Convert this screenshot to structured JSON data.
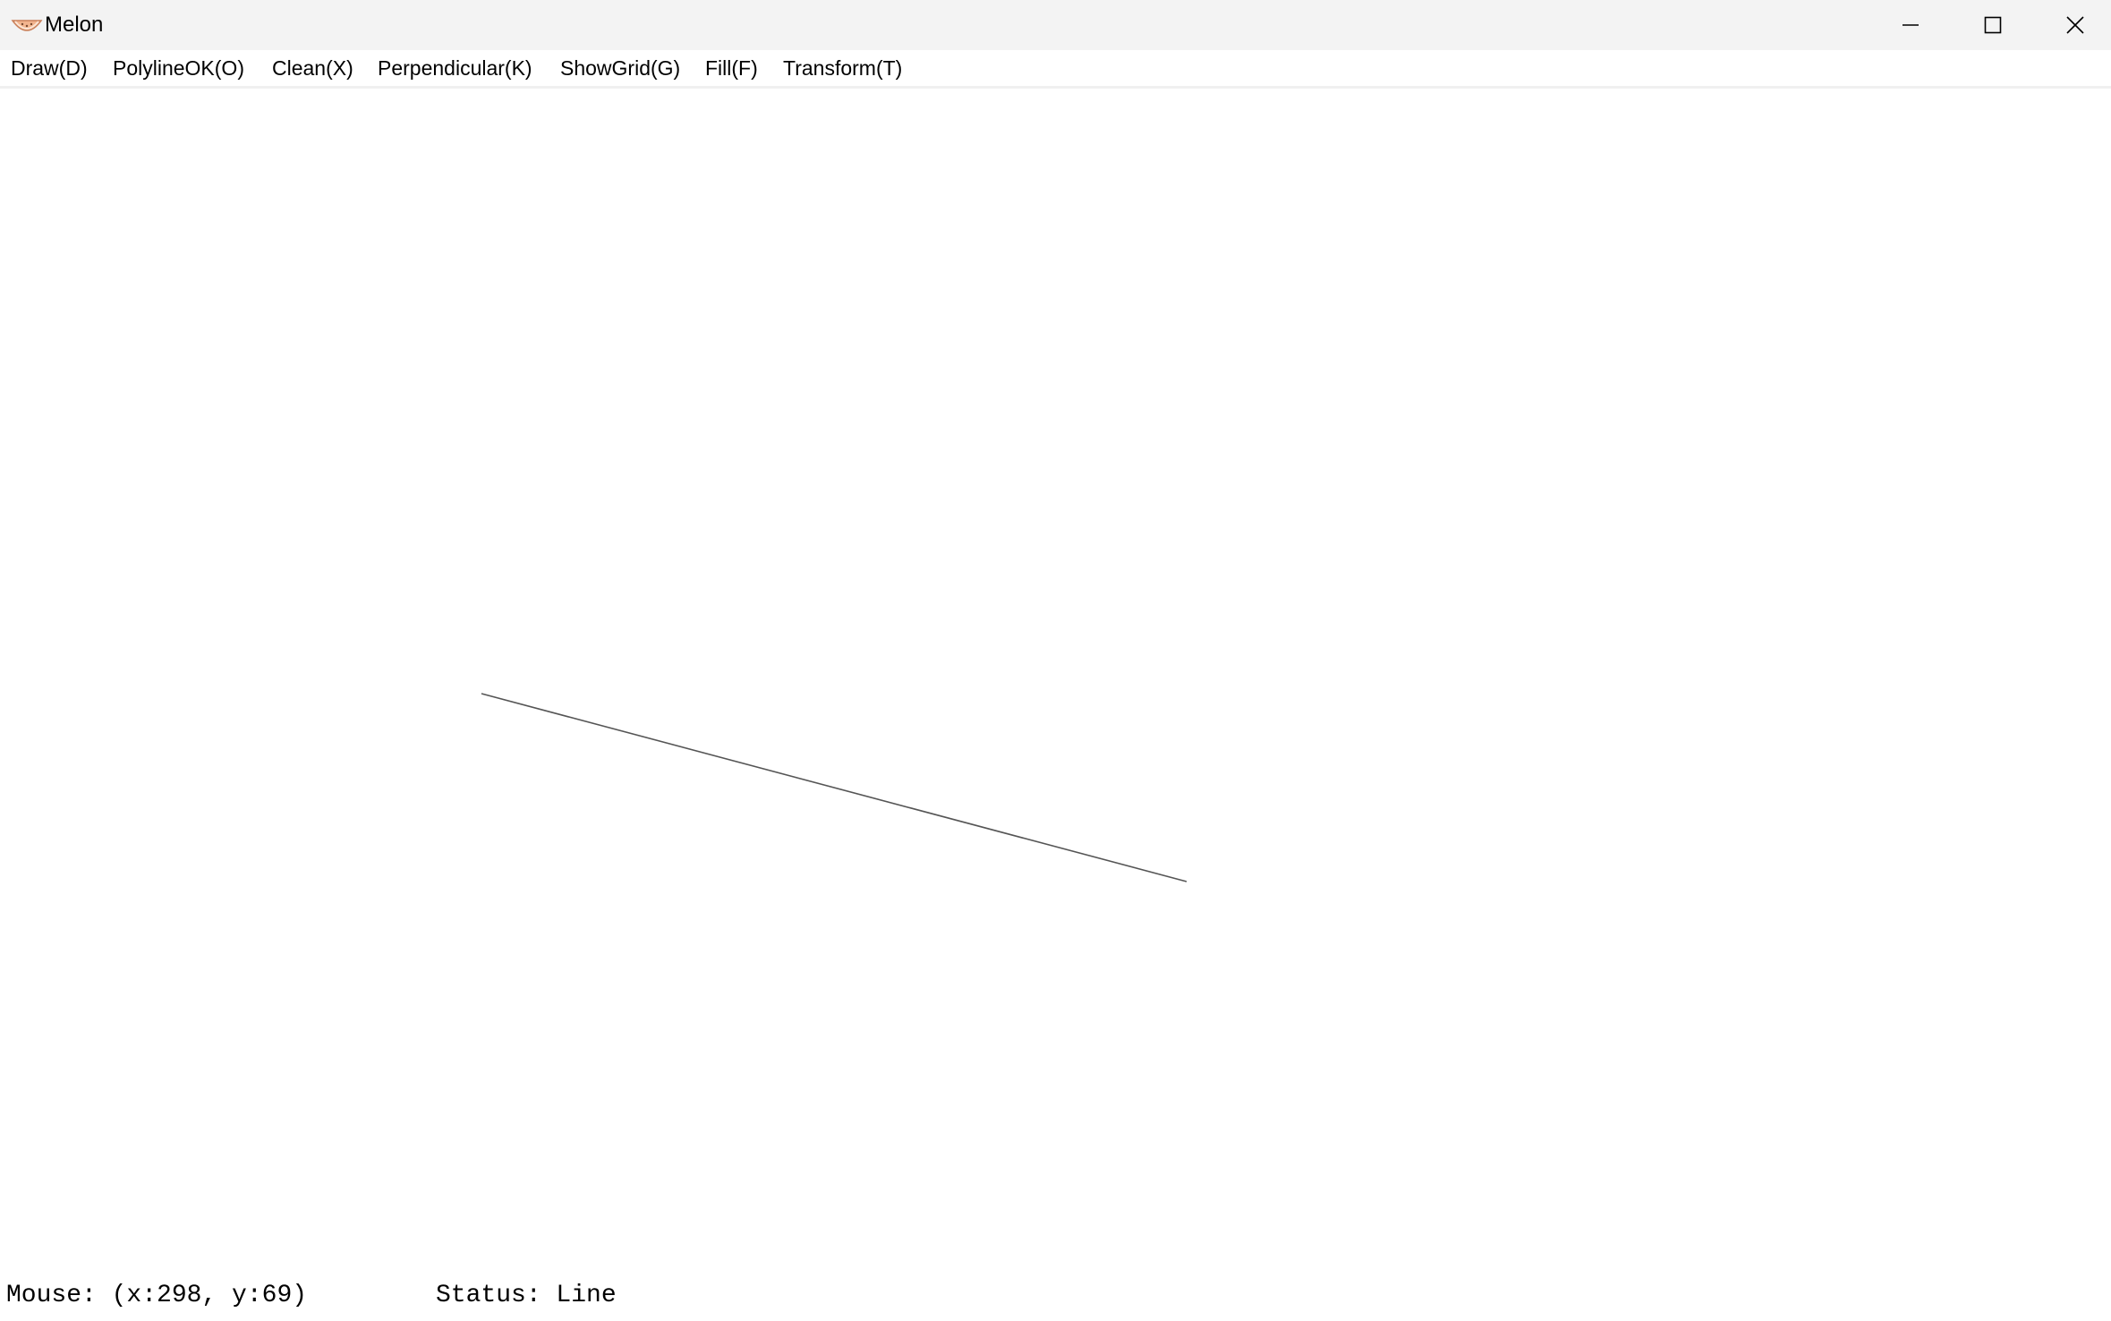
{
  "window": {
    "title": "Melon",
    "icon": "melon-slice-icon",
    "controls": [
      "minimize-icon",
      "maximize-icon",
      "close-icon"
    ]
  },
  "menu": {
    "items": [
      {
        "label": "Draw(D)"
      },
      {
        "label": "PolylineOK(O)"
      },
      {
        "label": "Clean(X)"
      },
      {
        "label": "Perpendicular(K)"
      },
      {
        "label": "ShowGrid(G)"
      },
      {
        "label": "Fill(F)"
      },
      {
        "label": "Transform(T)"
      }
    ]
  },
  "statusbar": {
    "mouse": "Mouse: (x:298, y:69)",
    "status": "Status: Line"
  },
  "colors": {
    "titlebar": "#f3f3f3",
    "canvas": "#ffffff",
    "line": "#555555"
  }
}
